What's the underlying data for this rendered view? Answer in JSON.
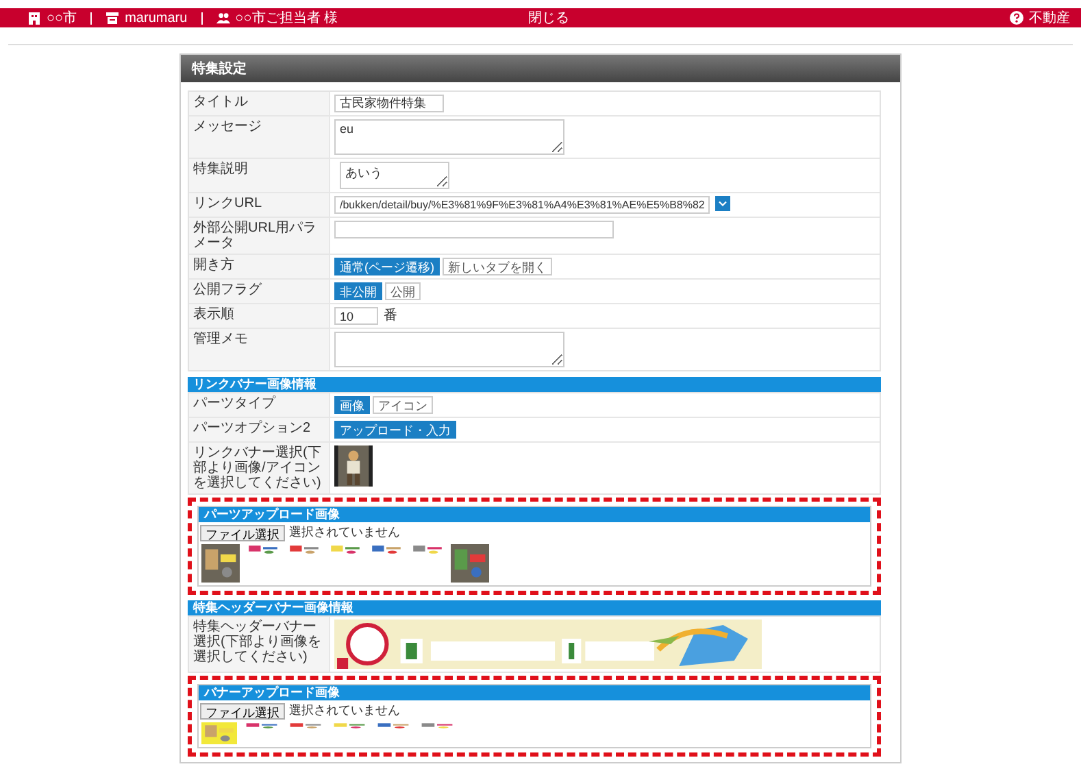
{
  "top_bar": {
    "items": [
      {
        "text": "○○市"
      },
      {
        "text": "marumaru"
      },
      {
        "text": "○○市ご担当者 様"
      }
    ],
    "center": "閉じる",
    "right": {
      "text": "不動産"
    }
  },
  "panel": {
    "title": "特集設定",
    "rows": [
      {
        "label": "タイトル",
        "kind": "text",
        "value": "古民家物件特集"
      },
      {
        "label": "メッセージ",
        "kind": "textarea",
        "value": "eu"
      },
      {
        "label": "特集説明",
        "kind": "small_textarea",
        "value": "あいう"
      },
      {
        "label": "リンクURL",
        "kind": "url",
        "value": "/bukken/detail/buy/%E3%81%9F%E3%81%A4%E3%81%AE%E5%B8%82"
      },
      {
        "label": "外部公開URL用パラメータ",
        "kind": "text"
      },
      {
        "label": "開き方",
        "kind": "toggle",
        "options": [
          {
            "label": "通常(ページ遷移)",
            "selected": true
          },
          {
            "label": "新しいタブを開く",
            "selected": false
          }
        ]
      },
      {
        "label": "公開フラグ",
        "kind": "toggle",
        "options": [
          {
            "label": "非公開",
            "selected": true
          },
          {
            "label": "公開",
            "selected": false
          }
        ]
      },
      {
        "label": "表示順",
        "kind": "number",
        "value": "10",
        "suffix": "番"
      },
      {
        "label": "管理メモ",
        "kind": "textarea"
      }
    ],
    "sections": [
      {
        "title": "リンクバナー画像情報",
        "rows": [
          {
            "label": "パーツタイプ",
            "kind": "toggle",
            "options": [
              {
                "label": "画像",
                "selected": true
              },
              {
                "label": "アイコン",
                "selected": false
              }
            ]
          },
          {
            "label": "パーツオプション2",
            "kind": "toggle",
            "options": [
              {
                "label": "アップロード・入力",
                "selected": true
              }
            ]
          },
          {
            "label": "リンクバナー選択(下部より画像/アイコンを選択してください)",
            "kind": "thumb"
          }
        ],
        "upload": {
          "title": "パーツアップロード画像",
          "button": "ファイル選択",
          "status": "選択されていません"
        }
      },
      {
        "title": "特集ヘッダーバナー画像情報",
        "rows": [
          {
            "label": "特集ヘッダーバナー選択(下部より画像を選択してください)",
            "kind": "banner"
          }
        ],
        "upload": {
          "title": "バナーアップロード画像",
          "button": "ファイル選択",
          "status": "選択されていません"
        }
      }
    ]
  }
}
